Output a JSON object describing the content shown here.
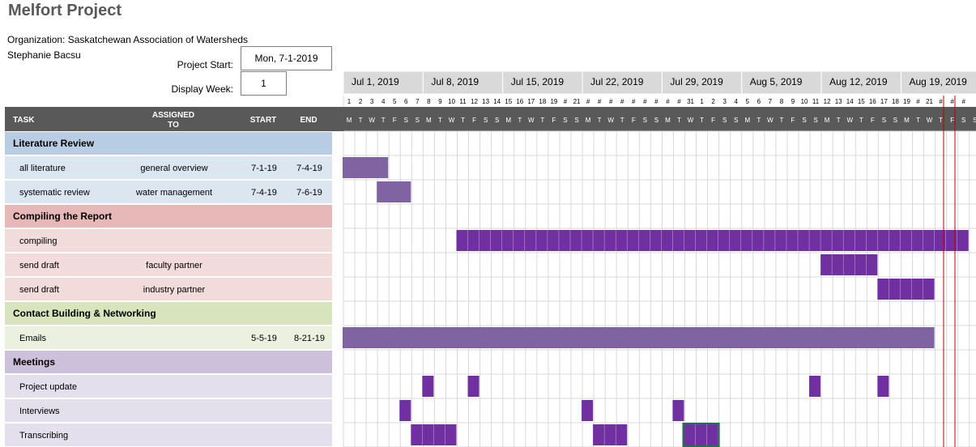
{
  "header": {
    "title": "Melfort Project",
    "organization": "Organization: Saskatchewan Association of Watersheds",
    "person": "Stephanie Bacsu",
    "project_start_label": "Project Start:",
    "project_start_value": "Mon, 7-1-2019",
    "display_week_label": "Display Week:",
    "display_week_value": "1"
  },
  "columns": {
    "task": "TASK",
    "assigned_line1": "ASSIGNED",
    "assigned_line2": "TO",
    "start": "START",
    "end": "END"
  },
  "weeks": [
    "Jul 1, 2019",
    "Jul 8, 2019",
    "Jul 15, 2019",
    "Jul 22, 2019",
    "Jul 29, 2019",
    "Aug 5, 2019",
    "Aug 12, 2019",
    "Aug 19, 2019"
  ],
  "day_numbers": [
    "1",
    "2",
    "3",
    "4",
    "5",
    "6",
    "7",
    "8",
    "9",
    "10",
    "11",
    "12",
    "13",
    "14",
    "15",
    "16",
    "17",
    "18",
    "19",
    "#",
    "21",
    "#",
    "#",
    "#",
    "#",
    "#",
    "#",
    "#",
    "#",
    "#",
    "31",
    "1",
    "2",
    "3",
    "4",
    "5",
    "6",
    "7",
    "8",
    "9",
    "10",
    "11",
    "12",
    "13",
    "14",
    "15",
    "16",
    "17",
    "18",
    "19",
    "#",
    "21",
    "#",
    "#",
    "#"
  ],
  "day_letters": [
    "M",
    "T",
    "W",
    "T",
    "F",
    "S",
    "S",
    "M",
    "T",
    "W",
    "T",
    "F",
    "S",
    "S",
    "M",
    "T",
    "W",
    "T",
    "F",
    "S",
    "S",
    "M",
    "T",
    "W",
    "T",
    "F",
    "S",
    "S",
    "M",
    "T",
    "W",
    "T",
    "F",
    "S",
    "S",
    "M",
    "T",
    "W",
    "T",
    "F",
    "S",
    "S",
    "M",
    "T",
    "W",
    "T",
    "F",
    "S",
    "S",
    "M",
    "T",
    "W",
    "T",
    "F",
    "S",
    "S"
  ],
  "colors": {
    "header_bg": "#595959",
    "bar_purple": "#8064a2",
    "bar_dark": "#7030a0",
    "today_line": "#c00000",
    "grid": "#d9d9d9"
  },
  "rows": [
    {
      "kind": "section",
      "task": "Literature Review",
      "bg": "#b8cce4"
    },
    {
      "kind": "task",
      "task": "all literature",
      "assigned": "general overview",
      "start": "7-1-19",
      "end": "7-4-19",
      "bg": "#dce6f1",
      "bars": [
        {
          "from": 0,
          "to": 4,
          "style": "light"
        }
      ]
    },
    {
      "kind": "task",
      "task": "systematic review",
      "assigned": "water management",
      "start": "7-4-19",
      "end": "7-6-19",
      "bg": "#dce6f1",
      "bars": [
        {
          "from": 3,
          "to": 6,
          "style": "light"
        }
      ]
    },
    {
      "kind": "section",
      "task": "Compiling the Report",
      "bg": "#e6b8b7"
    },
    {
      "kind": "task",
      "task": "compiling",
      "assigned": "",
      "start": "",
      "end": "",
      "bg": "#f2dcdb",
      "bars": [
        {
          "from": 10,
          "to": 55,
          "style": "dark"
        }
      ]
    },
    {
      "kind": "task",
      "task": "send draft",
      "assigned": "faculty partner",
      "start": "",
      "end": "",
      "bg": "#f2dcdb",
      "bars": [
        {
          "from": 42,
          "to": 47,
          "style": "dark"
        }
      ]
    },
    {
      "kind": "task",
      "task": "send draft",
      "assigned": "industry partner",
      "start": "",
      "end": "",
      "bg": "#f2dcdb",
      "bars": [
        {
          "from": 47,
          "to": 52,
          "style": "dark"
        }
      ]
    },
    {
      "kind": "section",
      "task": "Contact Building & Networking",
      "bg": "#d8e4bc"
    },
    {
      "kind": "task",
      "task": "Emails",
      "assigned": "",
      "start": "5-5-19",
      "end": "8-21-19",
      "bg": "#ebf1de",
      "bars": [
        {
          "from": 0,
          "to": 52,
          "style": "light"
        }
      ]
    },
    {
      "kind": "section",
      "task": "Meetings",
      "bg": "#ccc0da"
    },
    {
      "kind": "task",
      "task": "Project update",
      "assigned": "",
      "start": "",
      "end": "",
      "bg": "#e4dfec",
      "bars": [
        {
          "from": 7,
          "to": 8,
          "style": "dark"
        },
        {
          "from": 11,
          "to": 12,
          "style": "dark"
        },
        {
          "from": 41,
          "to": 42,
          "style": "dark"
        },
        {
          "from": 47,
          "to": 48,
          "style": "dark"
        }
      ]
    },
    {
      "kind": "task",
      "task": "Interviews",
      "assigned": "",
      "start": "",
      "end": "",
      "bg": "#e4dfec",
      "bars": [
        {
          "from": 5,
          "to": 6,
          "style": "dark"
        },
        {
          "from": 21,
          "to": 22,
          "style": "dark"
        },
        {
          "from": 29,
          "to": 30,
          "style": "dark"
        }
      ]
    },
    {
      "kind": "task",
      "task": "Transcribing",
      "assigned": "",
      "start": "",
      "end": "",
      "bg": "#e4dfec",
      "bars": [
        {
          "from": 6,
          "to": 10,
          "style": "dark"
        },
        {
          "from": 22,
          "to": 25,
          "style": "dark"
        },
        {
          "from": 30,
          "to": 33,
          "style": "dark",
          "selected": true
        }
      ]
    }
  ]
}
